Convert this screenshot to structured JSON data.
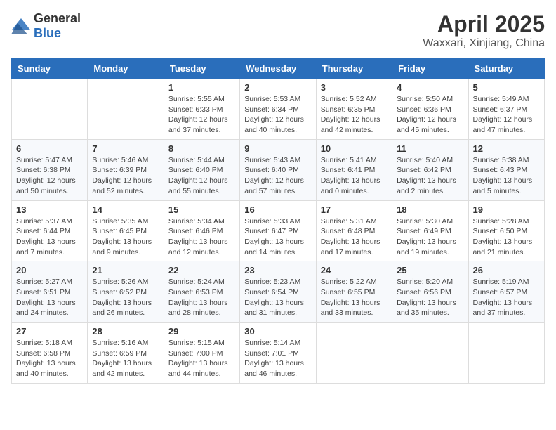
{
  "logo": {
    "general": "General",
    "blue": "Blue"
  },
  "title": "April 2025",
  "location": "Waxxari, Xinjiang, China",
  "weekdays": [
    "Sunday",
    "Monday",
    "Tuesday",
    "Wednesday",
    "Thursday",
    "Friday",
    "Saturday"
  ],
  "weeks": [
    [
      {
        "day": "",
        "info": ""
      },
      {
        "day": "",
        "info": ""
      },
      {
        "day": "1",
        "info": "Sunrise: 5:55 AM\nSunset: 6:33 PM\nDaylight: 12 hours and 37 minutes."
      },
      {
        "day": "2",
        "info": "Sunrise: 5:53 AM\nSunset: 6:34 PM\nDaylight: 12 hours and 40 minutes."
      },
      {
        "day": "3",
        "info": "Sunrise: 5:52 AM\nSunset: 6:35 PM\nDaylight: 12 hours and 42 minutes."
      },
      {
        "day": "4",
        "info": "Sunrise: 5:50 AM\nSunset: 6:36 PM\nDaylight: 12 hours and 45 minutes."
      },
      {
        "day": "5",
        "info": "Sunrise: 5:49 AM\nSunset: 6:37 PM\nDaylight: 12 hours and 47 minutes."
      }
    ],
    [
      {
        "day": "6",
        "info": "Sunrise: 5:47 AM\nSunset: 6:38 PM\nDaylight: 12 hours and 50 minutes."
      },
      {
        "day": "7",
        "info": "Sunrise: 5:46 AM\nSunset: 6:39 PM\nDaylight: 12 hours and 52 minutes."
      },
      {
        "day": "8",
        "info": "Sunrise: 5:44 AM\nSunset: 6:40 PM\nDaylight: 12 hours and 55 minutes."
      },
      {
        "day": "9",
        "info": "Sunrise: 5:43 AM\nSunset: 6:40 PM\nDaylight: 12 hours and 57 minutes."
      },
      {
        "day": "10",
        "info": "Sunrise: 5:41 AM\nSunset: 6:41 PM\nDaylight: 13 hours and 0 minutes."
      },
      {
        "day": "11",
        "info": "Sunrise: 5:40 AM\nSunset: 6:42 PM\nDaylight: 13 hours and 2 minutes."
      },
      {
        "day": "12",
        "info": "Sunrise: 5:38 AM\nSunset: 6:43 PM\nDaylight: 13 hours and 5 minutes."
      }
    ],
    [
      {
        "day": "13",
        "info": "Sunrise: 5:37 AM\nSunset: 6:44 PM\nDaylight: 13 hours and 7 minutes."
      },
      {
        "day": "14",
        "info": "Sunrise: 5:35 AM\nSunset: 6:45 PM\nDaylight: 13 hours and 9 minutes."
      },
      {
        "day": "15",
        "info": "Sunrise: 5:34 AM\nSunset: 6:46 PM\nDaylight: 13 hours and 12 minutes."
      },
      {
        "day": "16",
        "info": "Sunrise: 5:33 AM\nSunset: 6:47 PM\nDaylight: 13 hours and 14 minutes."
      },
      {
        "day": "17",
        "info": "Sunrise: 5:31 AM\nSunset: 6:48 PM\nDaylight: 13 hours and 17 minutes."
      },
      {
        "day": "18",
        "info": "Sunrise: 5:30 AM\nSunset: 6:49 PM\nDaylight: 13 hours and 19 minutes."
      },
      {
        "day": "19",
        "info": "Sunrise: 5:28 AM\nSunset: 6:50 PM\nDaylight: 13 hours and 21 minutes."
      }
    ],
    [
      {
        "day": "20",
        "info": "Sunrise: 5:27 AM\nSunset: 6:51 PM\nDaylight: 13 hours and 24 minutes."
      },
      {
        "day": "21",
        "info": "Sunrise: 5:26 AM\nSunset: 6:52 PM\nDaylight: 13 hours and 26 minutes."
      },
      {
        "day": "22",
        "info": "Sunrise: 5:24 AM\nSunset: 6:53 PM\nDaylight: 13 hours and 28 minutes."
      },
      {
        "day": "23",
        "info": "Sunrise: 5:23 AM\nSunset: 6:54 PM\nDaylight: 13 hours and 31 minutes."
      },
      {
        "day": "24",
        "info": "Sunrise: 5:22 AM\nSunset: 6:55 PM\nDaylight: 13 hours and 33 minutes."
      },
      {
        "day": "25",
        "info": "Sunrise: 5:20 AM\nSunset: 6:56 PM\nDaylight: 13 hours and 35 minutes."
      },
      {
        "day": "26",
        "info": "Sunrise: 5:19 AM\nSunset: 6:57 PM\nDaylight: 13 hours and 37 minutes."
      }
    ],
    [
      {
        "day": "27",
        "info": "Sunrise: 5:18 AM\nSunset: 6:58 PM\nDaylight: 13 hours and 40 minutes."
      },
      {
        "day": "28",
        "info": "Sunrise: 5:16 AM\nSunset: 6:59 PM\nDaylight: 13 hours and 42 minutes."
      },
      {
        "day": "29",
        "info": "Sunrise: 5:15 AM\nSunset: 7:00 PM\nDaylight: 13 hours and 44 minutes."
      },
      {
        "day": "30",
        "info": "Sunrise: 5:14 AM\nSunset: 7:01 PM\nDaylight: 13 hours and 46 minutes."
      },
      {
        "day": "",
        "info": ""
      },
      {
        "day": "",
        "info": ""
      },
      {
        "day": "",
        "info": ""
      }
    ]
  ]
}
